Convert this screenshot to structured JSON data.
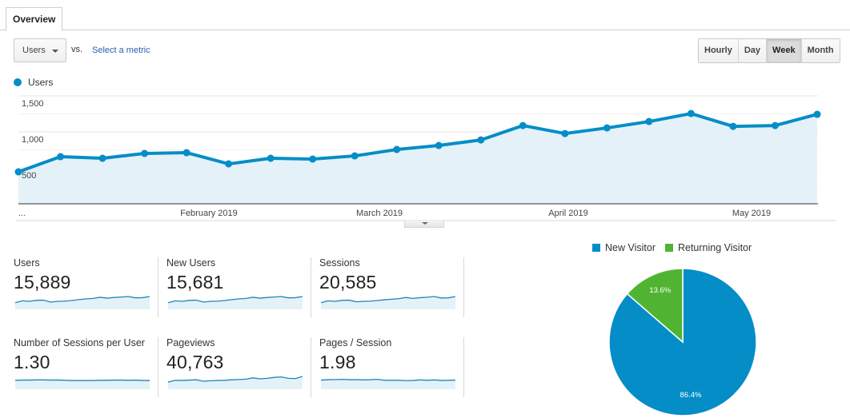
{
  "tabs": [
    {
      "label": "Overview",
      "active": true
    }
  ],
  "controls": {
    "metric_select": "Users",
    "vs_label": "vs.",
    "select_metric_link": "Select a metric",
    "granularity": [
      {
        "label": "Hourly",
        "active": false
      },
      {
        "label": "Day",
        "active": false
      },
      {
        "label": "Week",
        "active": true
      },
      {
        "label": "Month",
        "active": false
      }
    ]
  },
  "colors": {
    "primary": "#058dc7",
    "secondary": "#50b432",
    "fill": "#e5f1f8",
    "link": "#2a5db0"
  },
  "chart_data": [
    {
      "type": "area",
      "title": "",
      "legend": [
        "Users"
      ],
      "legend_position": "top-left",
      "ylim": [
        0,
        1500
      ],
      "yticks": [
        {
          "value": 500,
          "label": "500"
        },
        {
          "value": 1000,
          "label": "1,000"
        },
        {
          "value": 1500,
          "label": "1,500"
        }
      ],
      "xlabels": [
        "...",
        "February 2019",
        "March 2019",
        "April 2019",
        "May 2019"
      ],
      "grid": true,
      "series": [
        {
          "name": "Users",
          "values": [
            444,
            655,
            633,
            700,
            711,
            555,
            633,
            622,
            666,
            755,
            811,
            888,
            1088,
            977,
            1055,
            1144,
            1255,
            1077,
            1088,
            1244
          ]
        }
      ]
    },
    {
      "type": "pie",
      "legend": [
        "New Visitor",
        "Returning Visitor"
      ],
      "legend_position": "top",
      "slices": [
        {
          "label": "New Visitor",
          "value": 86.4,
          "display": "86.4%"
        },
        {
          "label": "Returning Visitor",
          "value": 13.6,
          "display": "13.6%"
        }
      ]
    }
  ],
  "kpis": [
    {
      "label": "Users",
      "value": "15,889",
      "spark": [
        0.35,
        0.55,
        0.5,
        0.6,
        0.62,
        0.42,
        0.5,
        0.52,
        0.58,
        0.68,
        0.75,
        0.8,
        0.92,
        0.83,
        0.9,
        0.95,
        1.0,
        0.86,
        0.88,
        1.0
      ]
    },
    {
      "label": "New Users",
      "value": "15,681",
      "spark": [
        0.35,
        0.55,
        0.5,
        0.6,
        0.62,
        0.42,
        0.5,
        0.52,
        0.58,
        0.68,
        0.75,
        0.8,
        0.92,
        0.83,
        0.9,
        0.95,
        1.0,
        0.86,
        0.88,
        1.0
      ]
    },
    {
      "label": "Sessions",
      "value": "20,585",
      "spark": [
        0.35,
        0.55,
        0.5,
        0.6,
        0.62,
        0.45,
        0.5,
        0.52,
        0.58,
        0.66,
        0.72,
        0.78,
        0.9,
        0.8,
        0.88,
        0.93,
        1.0,
        0.85,
        0.86,
        1.0
      ]
    },
    {
      "label": "Number of Sessions per User",
      "value": "1.30",
      "spark": [
        0.6,
        0.62,
        0.62,
        0.64,
        0.64,
        0.62,
        0.63,
        0.6,
        0.58,
        0.58,
        0.58,
        0.58,
        0.6,
        0.6,
        0.62,
        0.62,
        0.6,
        0.62,
        0.58,
        0.58
      ]
    },
    {
      "label": "Pageviews",
      "value": "40,763",
      "spark": [
        0.4,
        0.6,
        0.58,
        0.62,
        0.65,
        0.5,
        0.55,
        0.58,
        0.6,
        0.65,
        0.68,
        0.72,
        0.85,
        0.75,
        0.8,
        0.9,
        0.95,
        0.8,
        0.78,
        1.0
      ]
    },
    {
      "label": "Pages / Session",
      "value": "1.98",
      "spark": [
        0.62,
        0.66,
        0.68,
        0.7,
        0.66,
        0.66,
        0.64,
        0.66,
        0.7,
        0.6,
        0.6,
        0.6,
        0.56,
        0.58,
        0.64,
        0.6,
        0.64,
        0.58,
        0.6,
        0.62
      ]
    }
  ]
}
